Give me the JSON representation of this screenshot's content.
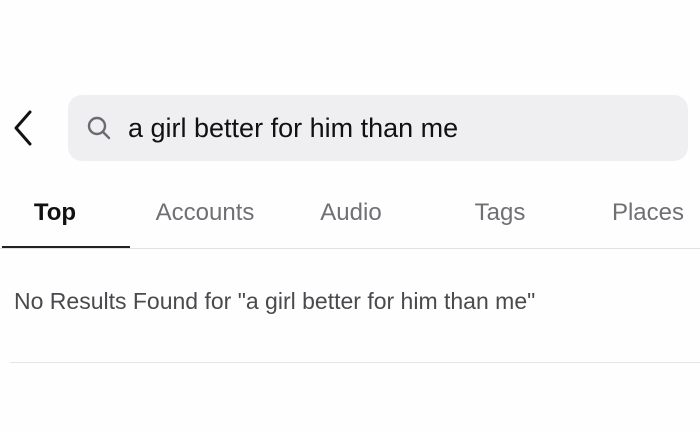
{
  "search": {
    "back_icon": "chevron-left-icon",
    "search_icon": "magnifier-icon",
    "query": "a girl better for him than me"
  },
  "tabs": {
    "items": [
      {
        "label": "Top",
        "active": true
      },
      {
        "label": "Accounts",
        "active": false
      },
      {
        "label": "Audio",
        "active": false
      },
      {
        "label": "Tags",
        "active": false
      },
      {
        "label": "Places",
        "active": false
      }
    ]
  },
  "results": {
    "empty_message": "No Results Found for \"a girl better for him than me\""
  },
  "colors": {
    "search_bg": "#efeff1",
    "active_tab": "#111111",
    "inactive_tab": "#707074"
  }
}
